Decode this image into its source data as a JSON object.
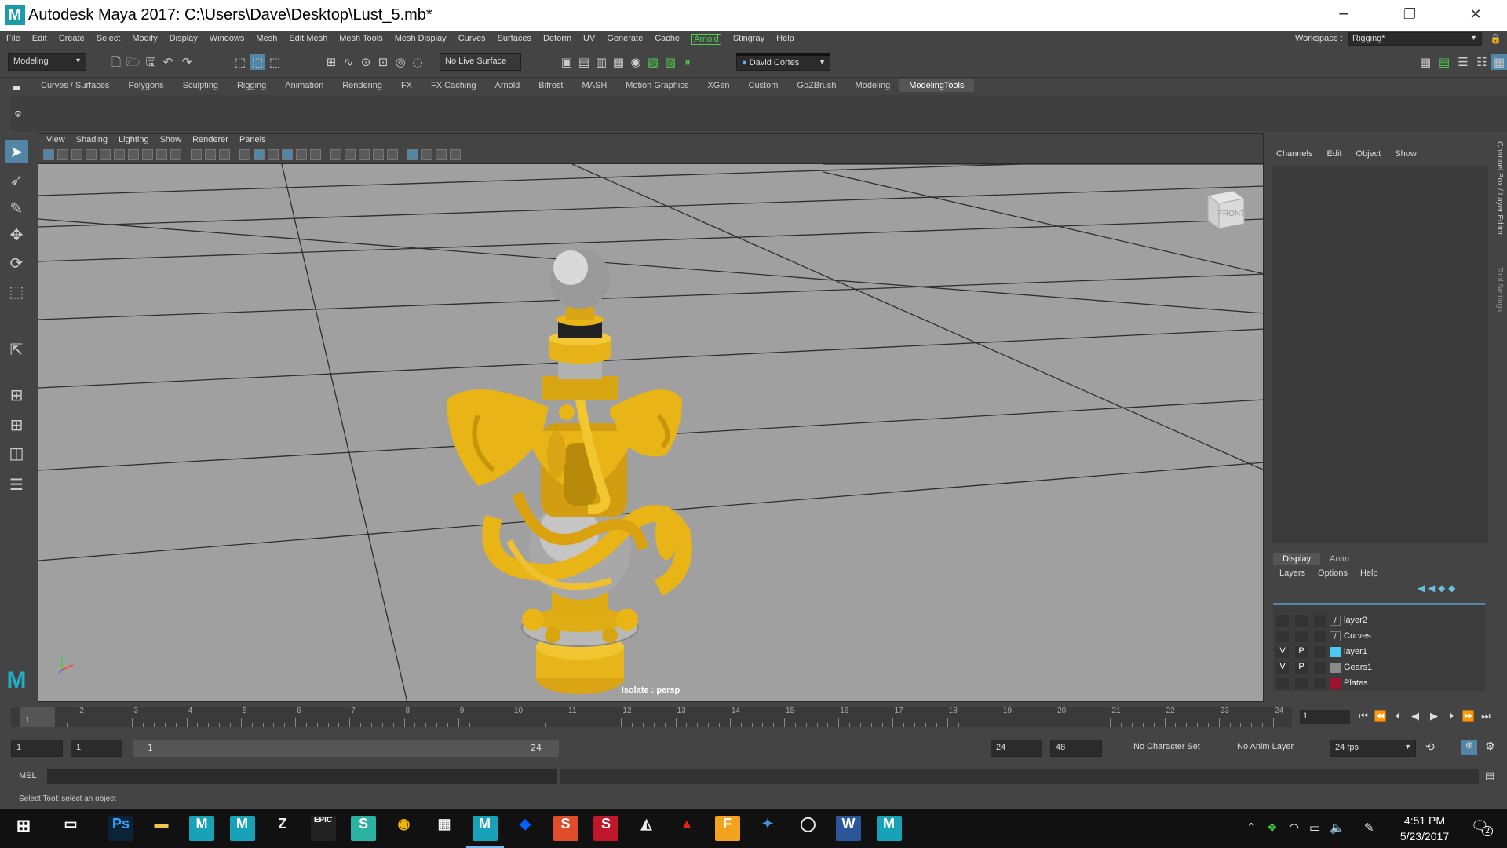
{
  "window": {
    "logo": "M",
    "title": "Autodesk Maya 2017: C:\\Users\\Dave\\Desktop\\Lust_5.mb*",
    "minimize": "─",
    "restore": "❐",
    "close": "✕"
  },
  "menubar": {
    "items": [
      "File",
      "Edit",
      "Create",
      "Select",
      "Modify",
      "Display",
      "Windows",
      "Mesh",
      "Edit Mesh",
      "Mesh Tools",
      "Mesh Display",
      "Curves",
      "Surfaces",
      "Deform",
      "UV",
      "Generate",
      "Cache",
      "Arnold",
      "Stingray",
      "Help"
    ],
    "workspace_label": "Workspace :",
    "workspace_value": "Rigging*"
  },
  "statusline": {
    "mode": "Modeling",
    "live_surface": "No Live Surface",
    "user": "David Cortes"
  },
  "shelf": {
    "tabs": [
      "Curves / Surfaces",
      "Polygons",
      "Sculpting",
      "Rigging",
      "Animation",
      "Rendering",
      "FX",
      "FX Caching",
      "Arnold",
      "Bifrost",
      "MASH",
      "Motion Graphics",
      "XGen",
      "Custom",
      "GoZBrush",
      "Modeling",
      "ModelingTools"
    ],
    "active_tab": "ModelingTools"
  },
  "viewport": {
    "menu": [
      "View",
      "Shading",
      "Lighting",
      "Show",
      "Renderer",
      "Panels"
    ],
    "cube_label": "FRONT",
    "isolate_label": "Isolate : persp"
  },
  "channelbox": {
    "menu": [
      "Channels",
      "Edit",
      "Object",
      "Show"
    ],
    "side_label": "Channel Box / Layer Editor",
    "side_label2": "Tool Settings"
  },
  "layer_editor": {
    "tabs": [
      "Display",
      "Anim"
    ],
    "menu": [
      "Layers",
      "Options",
      "Help"
    ],
    "layers": [
      {
        "v": "",
        "p": "",
        "name": "layer2",
        "color": "#3c3c3c",
        "curve": true
      },
      {
        "v": "",
        "p": "",
        "name": "Curves",
        "color": "#3c3c3c",
        "curve": true
      },
      {
        "v": "V",
        "p": "P",
        "name": "layer1",
        "color": "#4cc9f0",
        "curve": false
      },
      {
        "v": "V",
        "p": "P",
        "name": "Gears1",
        "color": "#8a8a8a",
        "curve": false
      },
      {
        "v": "",
        "p": "",
        "name": "Plates",
        "color": "#a01030",
        "curve": false
      }
    ]
  },
  "timeslider": {
    "ticks": [
      "1",
      "2",
      "3",
      "4",
      "5",
      "6",
      "7",
      "8",
      "9",
      "10",
      "11",
      "12",
      "13",
      "14",
      "15",
      "16",
      "17",
      "18",
      "19",
      "20",
      "21",
      "22",
      "23",
      "24"
    ],
    "current_frame": "1"
  },
  "rangeslider": {
    "start": "1",
    "playback_start": "1",
    "range_start": "1",
    "range_end": "24",
    "playback_end": "24",
    "end": "48",
    "character_set": "No Character Set",
    "anim_layer": "No Anim Layer",
    "fps": "24 fps"
  },
  "cmdline": {
    "label": "MEL",
    "help": "Select Tool: select an object"
  },
  "taskbar": {
    "time": "4:51 PM",
    "date": "5/23/2017",
    "notifications": "2",
    "apps": [
      {
        "name": "photoshop-icon",
        "glyph": "Ps",
        "bg": "#0b2239",
        "fg": "#31a8ff"
      },
      {
        "name": "file-explorer-icon",
        "glyph": "▬",
        "bg": "#111",
        "fg": "#f3c74f"
      },
      {
        "name": "maya-icon-1",
        "glyph": "M",
        "bg": "#17a2b8",
        "fg": "#fff"
      },
      {
        "name": "maya-icon-2",
        "glyph": "M",
        "bg": "#17a2b8",
        "fg": "#fff"
      },
      {
        "name": "zbrush-icon",
        "glyph": "Z",
        "bg": "#111",
        "fg": "#eee"
      },
      {
        "name": "epic-games-icon",
        "glyph": "EPIC",
        "bg": "#222",
        "fg": "#fff"
      },
      {
        "name": "substance-icon",
        "glyph": "S",
        "bg": "#2ab3a3",
        "fg": "#fff"
      },
      {
        "name": "chrome-icon",
        "glyph": "◉",
        "bg": "#111",
        "fg": "#f4b400"
      },
      {
        "name": "calculator-icon",
        "glyph": "▦",
        "bg": "#111",
        "fg": "#eee"
      },
      {
        "name": "maya-icon-3",
        "glyph": "M",
        "bg": "#17a2b8",
        "fg": "#fff"
      },
      {
        "name": "dropbox-icon",
        "glyph": "◆",
        "bg": "#111",
        "fg": "#0061fe"
      },
      {
        "name": "substance-designer-icon",
        "glyph": "S",
        "bg": "#e14d2a",
        "fg": "#fff"
      },
      {
        "name": "substance-painter-icon",
        "glyph": "S",
        "bg": "#c0172a",
        "fg": "#fff"
      },
      {
        "name": "unity-icon",
        "glyph": "◭",
        "bg": "#111",
        "fg": "#eee"
      },
      {
        "name": "acrobat-icon",
        "glyph": "▲",
        "bg": "#111",
        "fg": "#e2231a"
      },
      {
        "name": "fusion-icon",
        "glyph": "F",
        "bg": "#f3a41c",
        "fg": "#fff"
      },
      {
        "name": "figure-icon",
        "glyph": "✦",
        "bg": "#111",
        "fg": "#4a90e2"
      },
      {
        "name": "oculus-icon",
        "glyph": "◯",
        "bg": "#111",
        "fg": "#eee"
      },
      {
        "name": "word-icon",
        "glyph": "W",
        "bg": "#2b579a",
        "fg": "#fff"
      },
      {
        "name": "maya-icon-4",
        "glyph": "M",
        "bg": "#17a2b8",
        "fg": "#fff"
      }
    ]
  },
  "colors": {
    "gold": "#e8b416",
    "silver": "#c8c8c8",
    "selection": "#5285a6",
    "arnold_green": "#4fcf4f"
  }
}
